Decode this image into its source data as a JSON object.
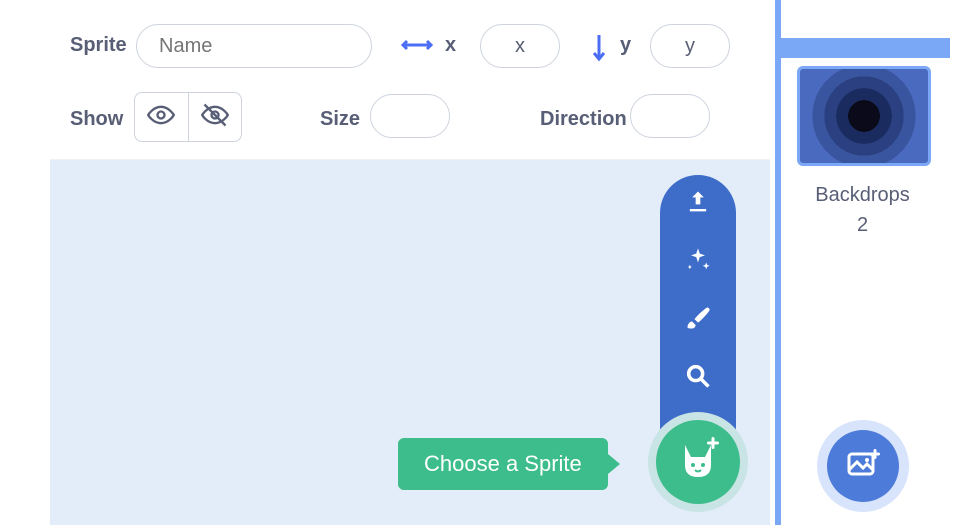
{
  "info": {
    "sprite_label": "Sprite",
    "name_placeholder": "Name",
    "x_label_1": "x",
    "x_value": "x",
    "y_label_1": "y",
    "y_value": "y",
    "show_label": "Show",
    "size_label": "Size",
    "size_value": "",
    "direction_label": "Direction",
    "direction_value": ""
  },
  "tooltip": "Choose a Sprite",
  "stage": {
    "backdrops_label": "Backdrops",
    "backdrops_count": "2"
  }
}
